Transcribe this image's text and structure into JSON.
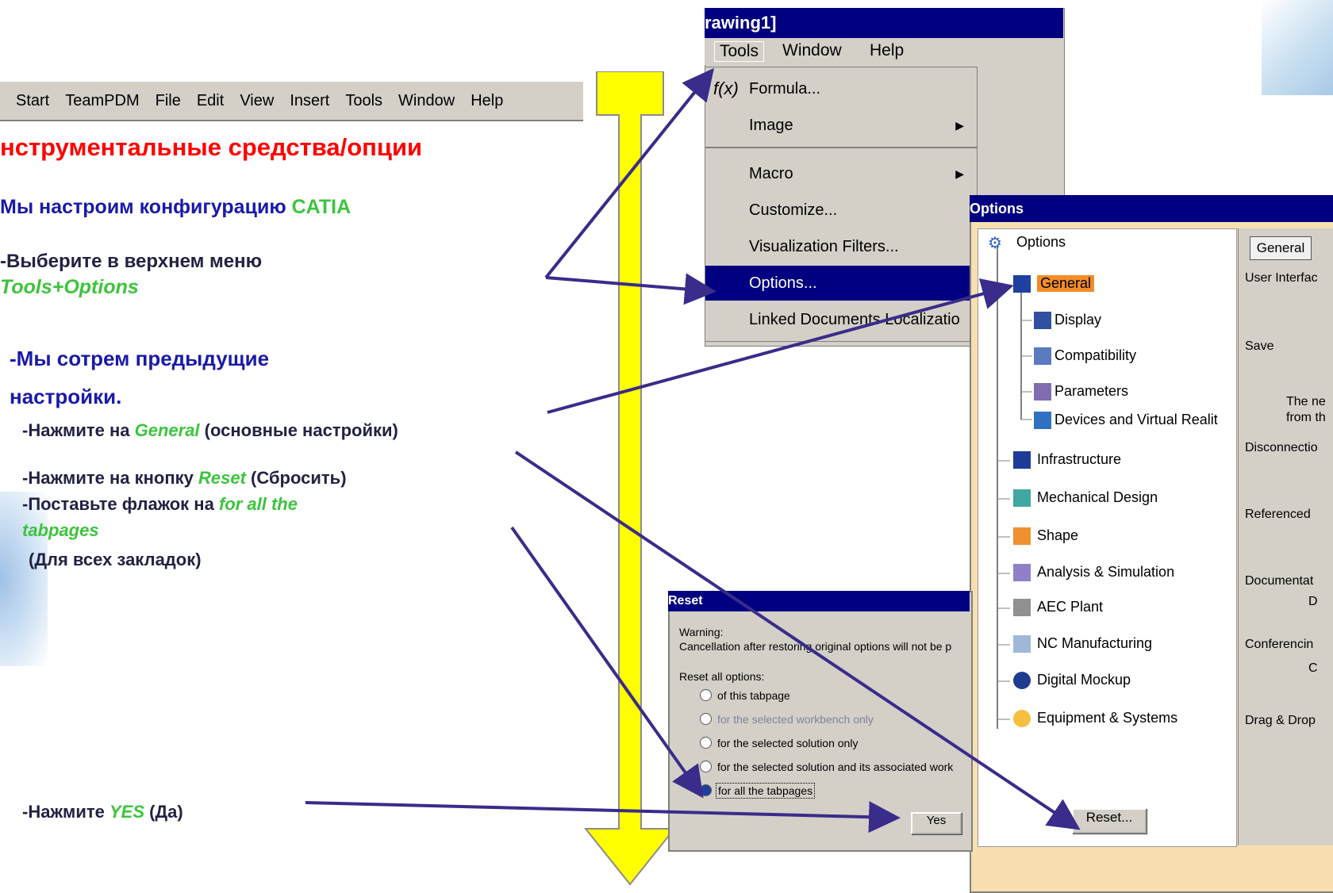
{
  "topMenu": [
    "Start",
    "TeamPDM",
    "File",
    "Edit",
    "View",
    "Insert",
    "Tools",
    "Window",
    "Help"
  ],
  "slide": {
    "heading": "нструментальные средства/опции",
    "line1_prefix": "Мы настроим конфигурацию ",
    "line1_catia": "CATIA",
    "line2": "-Выберите в верхнем меню",
    "line3": "Tools+Options",
    "line4": "-Мы сотрем предыдущие",
    "line5": "настройки.",
    "line6_prefix": "-Нажмите на ",
    "line6_general": "General",
    "line6_suffix": " (основные настройки)",
    "line7_prefix": "-Нажмите на кнопку ",
    "line7_reset": "Reset",
    "line7_suffix": " (Сбросить)",
    "line8_prefix": "-Поставьте флажок на ",
    "line8_tab": "for all the",
    "line9": "tabpages",
    "line10": "(Для всех закладок)",
    "line11_prefix": "-Нажмите ",
    "line11_yes": "YES",
    "line11_suffix": " (Да)"
  },
  "toolsMenu": {
    "title": "rawing1]",
    "bar": [
      "Tools",
      "Window",
      "Help"
    ],
    "items": [
      "Formula...",
      "Image",
      "Macro",
      "Customize...",
      "Visualization Filters...",
      "Options...",
      "Linked Documents Localizatio"
    ]
  },
  "options": {
    "title": "Options",
    "tree": [
      "Options",
      "General",
      "Display",
      "Compatibility",
      "Parameters",
      "Devices and Virtual Realit",
      "Infrastructure",
      "Mechanical Design",
      "Shape",
      "Analysis & Simulation",
      "AEC Plant",
      "NC Manufacturing",
      "Digital Mockup",
      "Equipment & Systems"
    ],
    "tab": "General",
    "right": [
      "User Interfac",
      "Save",
      "The ne",
      "from th",
      "Disconnectio",
      "Referenced",
      "Documentat",
      "D",
      "Conferencin",
      "C",
      "Drag & Drop"
    ],
    "reset_button": "Reset..."
  },
  "resetDialog": {
    "title": "Reset",
    "warning": "Warning:",
    "message": "Cancellation after restoring original options will not be p",
    "reset_all": "Reset all options:",
    "opts": [
      "of this tabpage",
      "for the selected workbench only",
      "for the selected solution only",
      "for the selected solution and its associated work",
      "for all the tabpages"
    ],
    "yes": "Yes"
  }
}
